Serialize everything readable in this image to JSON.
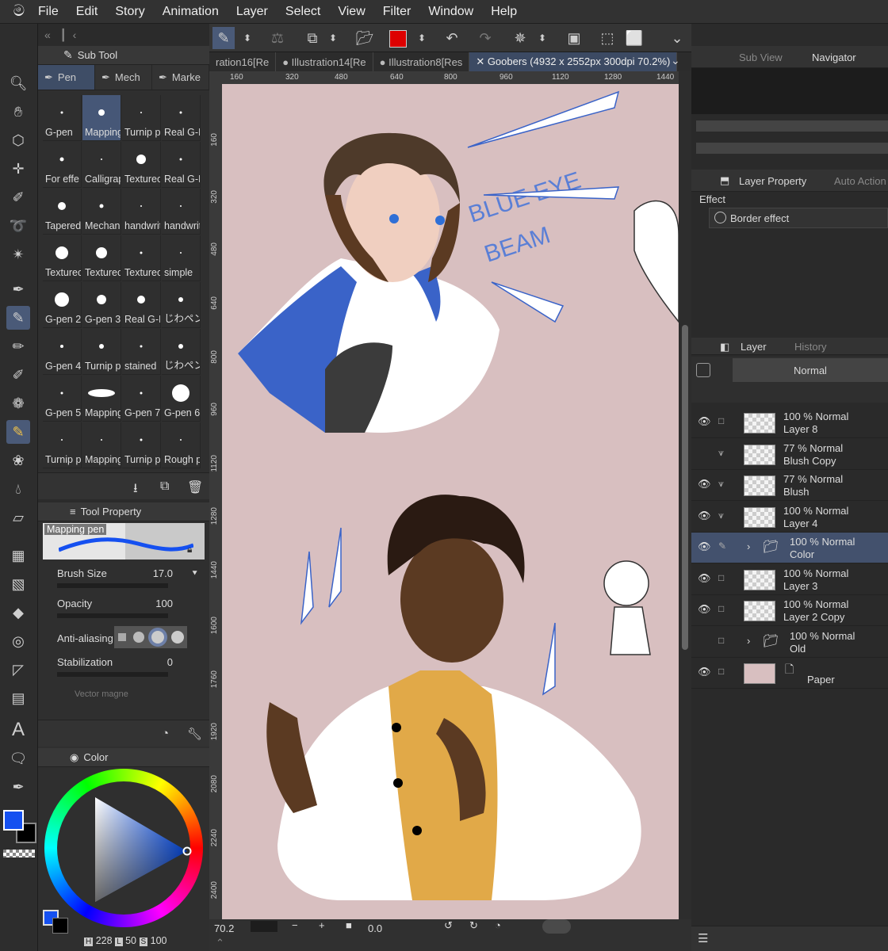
{
  "menu": [
    "File",
    "Edit",
    "Story",
    "Animation",
    "Layer",
    "Select",
    "View",
    "Filter",
    "Window",
    "Help"
  ],
  "tabs": [
    {
      "label": "ration16[Re"
    },
    {
      "label": "● Illustration14[Re"
    },
    {
      "label": "● Illustration8[Res"
    },
    {
      "label": "✕ Goobers (4932 x 2552px 300dpi 70.2%)"
    }
  ],
  "subtool": {
    "title": "Sub Tool",
    "tabs": [
      "Pen",
      "Mech",
      "Marke"
    ],
    "brushes": [
      "G-pen",
      "Mapping",
      "Turnip p",
      "Real G-P",
      "For effe",
      "Calligrap",
      "Texturec",
      "Real G-P",
      "Tapered",
      "Mechani",
      "handwrit",
      "handwrit",
      "Texturec",
      "Texturec",
      "Texturec",
      "simple",
      "G-pen 2",
      "G-pen 3",
      "Real G-P",
      "じわペン",
      "G-pen 4",
      "Turnip p",
      "stained",
      "じわペン",
      "G-pen 5",
      "Mapping",
      "G-pen 7",
      "G-pen 6",
      "Turnip p",
      "Mapping",
      "Turnip p",
      "Rough p"
    ]
  },
  "toolprop": {
    "title": "Tool Property",
    "brushname": "Mapping pen",
    "brush_size_label": "Brush Size",
    "brush_size": "17.0",
    "opacity_label": "Opacity",
    "opacity": "100",
    "aa_label": "Anti-aliasing",
    "stab_label": "Stabilization",
    "stab": "0",
    "vector_label": "Vector magne"
  },
  "color": {
    "title": "Color",
    "main": "#1550f0",
    "sub": "#000000",
    "readout_h": "228",
    "readout_s": "50",
    "readout_v": "100",
    "h_label": "H",
    "s_label": "L",
    "v_label": "S"
  },
  "rulers": {
    "top": [
      "160",
      "320",
      "480",
      "640",
      "800",
      "960",
      "1120",
      "1280",
      "1440"
    ],
    "left": [
      "160",
      "320",
      "480",
      "640",
      "800",
      "960",
      "1120",
      "1280",
      "1440",
      "1600",
      "1760",
      "1920",
      "2080",
      "2240",
      "2400"
    ]
  },
  "canvas": {
    "text1": "BLUE EYE",
    "text2": "BEAM"
  },
  "bottombar": {
    "zoom": "70.2",
    "angle": "0.0"
  },
  "right": {
    "subview_tab": "Sub View",
    "navigator_tab": "Navigator",
    "layerprop_tab": "Layer Property",
    "autoaction_tab": "Auto Action",
    "effect_label": "Effect",
    "border_effect": "Border effect",
    "layer_tab": "Layer",
    "history_tab": "History",
    "blend": "Normal"
  },
  "layers": [
    {
      "pct": "100 %",
      "mode": "Normal",
      "name": "Layer 8",
      "vis": true,
      "clip": false,
      "folder": false,
      "sel": false
    },
    {
      "pct": "77 %",
      "mode": "Normal",
      "name": "Blush Copy",
      "vis": false,
      "clip": true,
      "folder": false,
      "sel": false
    },
    {
      "pct": "77 %",
      "mode": "Normal",
      "name": "Blush",
      "vis": true,
      "clip": true,
      "folder": false,
      "sel": false
    },
    {
      "pct": "100 %",
      "mode": "Normal",
      "name": "Layer 4",
      "vis": true,
      "clip": true,
      "folder": false,
      "sel": false
    },
    {
      "pct": "100 %",
      "mode": "Normal",
      "name": "Color",
      "vis": true,
      "clip": false,
      "folder": true,
      "sel": true
    },
    {
      "pct": "100 %",
      "mode": "Normal",
      "name": "Layer 3",
      "vis": true,
      "clip": false,
      "folder": false,
      "sel": false
    },
    {
      "pct": "100 %",
      "mode": "Normal",
      "name": "Layer 2 Copy",
      "vis": true,
      "clip": false,
      "folder": false,
      "sel": false
    },
    {
      "pct": "100 %",
      "mode": "Normal",
      "name": "Old",
      "vis": false,
      "clip": false,
      "folder": true,
      "sel": false
    },
    {
      "pct": "",
      "mode": "",
      "name": "Paper",
      "vis": true,
      "clip": false,
      "folder": false,
      "sel": false
    }
  ]
}
